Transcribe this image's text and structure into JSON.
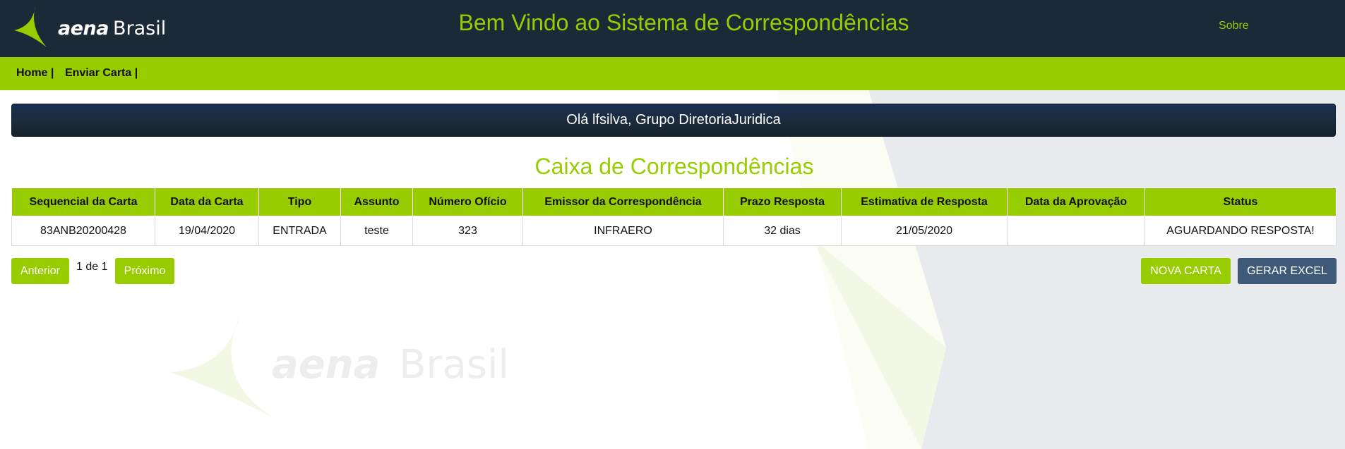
{
  "header": {
    "logo_bold": "aena",
    "logo_light": "Brasil",
    "title": "Bem Vindo ao Sistema de Correspondências",
    "about_label": "Sobre"
  },
  "nav": {
    "items": [
      {
        "label": "Home |"
      },
      {
        "label": "Enviar Carta |"
      }
    ]
  },
  "welcome": {
    "message": "Olá lfsilva, Grupo DiretoriaJuridica"
  },
  "mailbox": {
    "title": "Caixa de Correspondências",
    "columns": [
      "Sequencial da Carta",
      "Data da Carta",
      "Tipo",
      "Assunto",
      "Número Ofício",
      "Emissor da Correspondência",
      "Prazo Resposta",
      "Estimativa de Resposta",
      "Data da Aprovação",
      "Status"
    ],
    "rows": [
      {
        "sequencial": "83ANB20200428",
        "data_carta": "19/04/2020",
        "tipo": "ENTRADA",
        "assunto": "teste",
        "numero_oficio": "323",
        "emissor": "INFRAERO",
        "prazo": "32 dias",
        "estimativa": "21/05/2020",
        "data_aprovacao": "",
        "status": "AGUARDANDO RESPOSTA!"
      }
    ]
  },
  "pagination": {
    "prev_label": "Anterior",
    "page_info": "1 de 1",
    "next_label": "Próximo"
  },
  "actions": {
    "new_letter_label": "NOVA CARTA",
    "excel_label": "GERAR EXCEL"
  },
  "watermark": {
    "bold": "aena",
    "light": "Brasil"
  },
  "colors": {
    "header_bg": "#1c2a38",
    "accent_green": "#97cd00",
    "excel_button": "#3f5a78"
  },
  "icons": {
    "logo": "aena-triangle-logo-icon"
  }
}
